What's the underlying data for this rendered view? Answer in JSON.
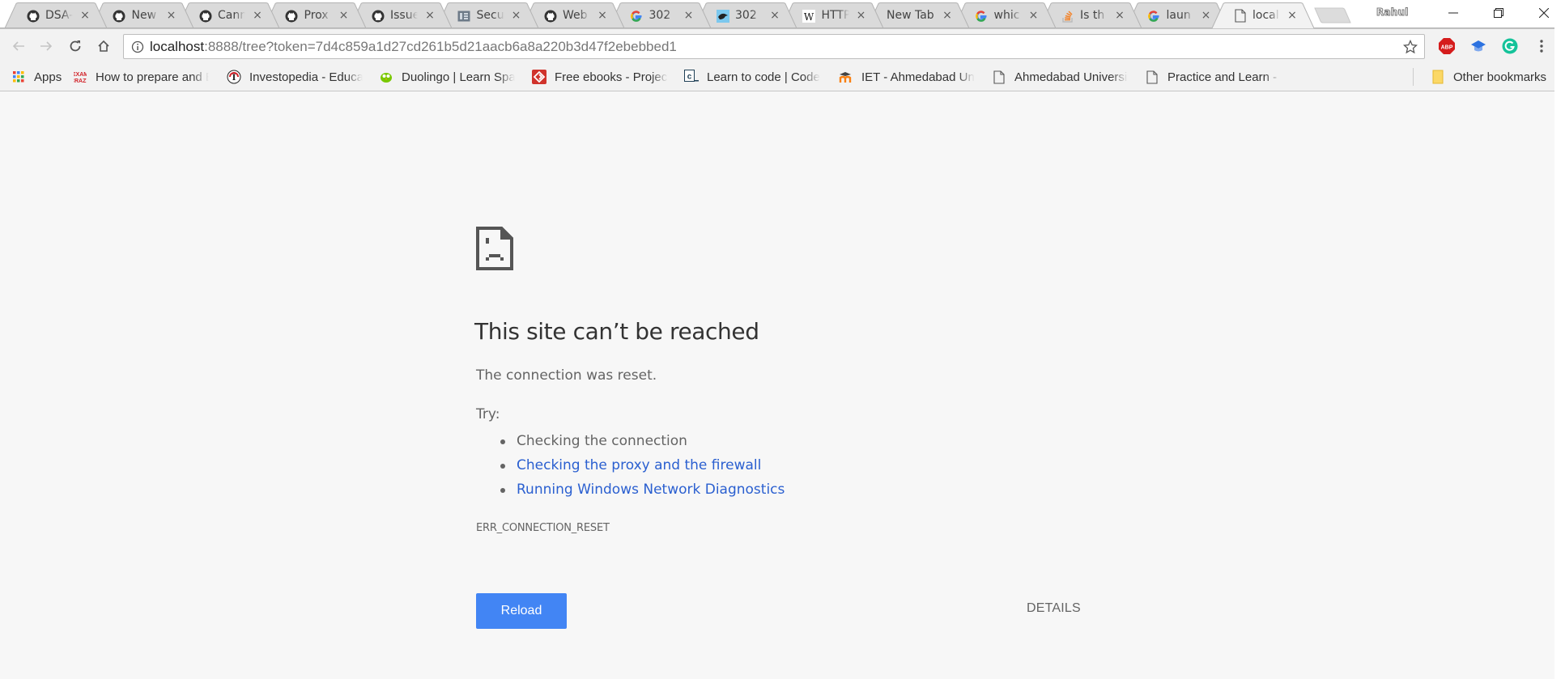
{
  "browser": {
    "profile_name": "Rahul",
    "tabs": [
      {
        "title": "DSA-",
        "favicon": "github-icon",
        "active": false
      },
      {
        "title": "New",
        "favicon": "github-icon",
        "active": false
      },
      {
        "title": "Cann",
        "favicon": "github-icon",
        "active": false
      },
      {
        "title": "Prox",
        "favicon": "github-icon",
        "active": false
      },
      {
        "title": "Issue",
        "favicon": "github-icon",
        "active": false
      },
      {
        "title": "Secu",
        "favicon": "document-grid-icon",
        "active": false
      },
      {
        "title": "Web",
        "favicon": "github-icon",
        "active": false
      },
      {
        "title": "302",
        "favicon": "google-icon",
        "active": false
      },
      {
        "title": "302",
        "favicon": "bird-icon",
        "active": false
      },
      {
        "title": "HTTP",
        "favicon": "wikipedia-icon",
        "active": false
      },
      {
        "title": "New Tab",
        "favicon": "",
        "active": false
      },
      {
        "title": "whic",
        "favicon": "google-icon",
        "active": false
      },
      {
        "title": "Is th",
        "favicon": "stackoverflow-icon",
        "active": false
      },
      {
        "title": "laun",
        "favicon": "google-icon",
        "active": false
      },
      {
        "title": "local",
        "favicon": "page-icon",
        "active": true
      }
    ],
    "close_glyph": "×",
    "address": {
      "host": "localhost",
      "rest": ":8888/tree?token=7d4c859a1d27cd261b5d21aacb6a8a220b3d47f2ebebbed1"
    },
    "extensions": [
      "adblock-plus-icon",
      "graduation-cap-icon",
      "grammarly-icon"
    ],
    "bookmarks": [
      {
        "label": "Apps",
        "icon": "apps-grid-icon"
      },
      {
        "label": "How to prepare and E",
        "icon": "examcrazy-icon"
      },
      {
        "label": "Investopedia - Educat",
        "icon": "investopedia-icon"
      },
      {
        "label": "Duolingo | Learn Span",
        "icon": "duolingo-icon"
      },
      {
        "label": "Free ebooks - Project",
        "icon": "gutenberg-icon"
      },
      {
        "label": "Learn to code | Codec",
        "icon": "codecademy-icon"
      },
      {
        "label": "IET - Ahmedabad Uni",
        "icon": "moodle-icon"
      },
      {
        "label": "Ahmedabad Universit",
        "icon": "page-icon"
      },
      {
        "label": "Practice and Learn - G",
        "icon": "page-icon"
      }
    ],
    "bookmarks_overflow": "»",
    "other_bookmarks": "Other bookmarks"
  },
  "error_page": {
    "heading": "This site can’t be reached",
    "description": "The connection was reset.",
    "try_label": "Try:",
    "suggestions": [
      {
        "text": "Checking the connection",
        "link": false
      },
      {
        "text": "Checking the proxy and the firewall",
        "link": true
      },
      {
        "text": "Running Windows Network Diagnostics",
        "link": true
      }
    ],
    "error_code": "ERR_CONNECTION_RESET",
    "reload_label": "Reload",
    "details_label": "DETAILS",
    "colors": {
      "button": "#4285f4",
      "link": "#2a5fd0",
      "text": "#646464"
    }
  }
}
